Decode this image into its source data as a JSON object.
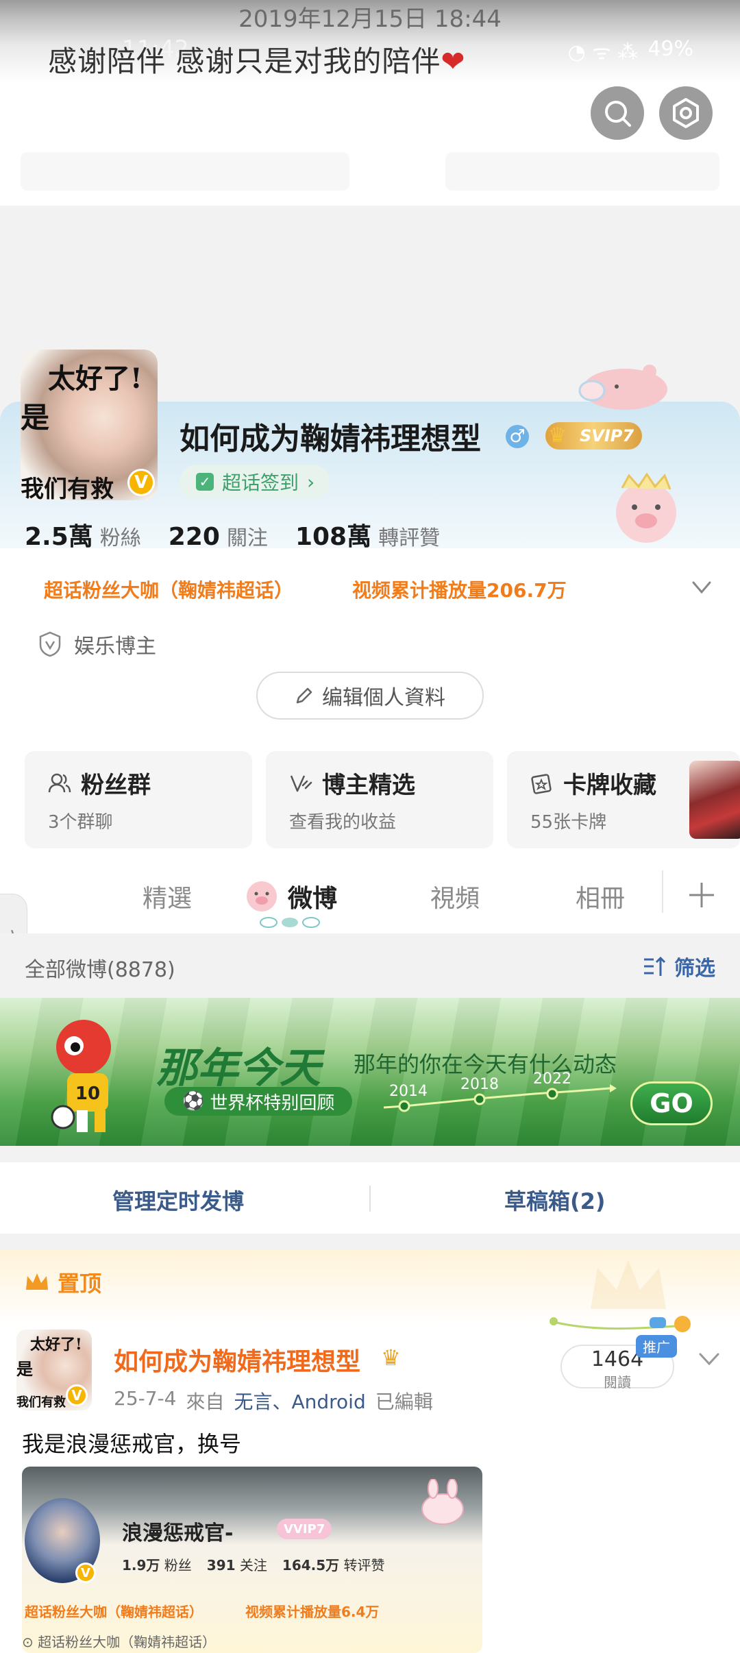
{
  "overlay": {
    "date": "2019年12月15日 18:44",
    "status_time": "11:42",
    "battery": "49%",
    "comment": "感谢陪伴 感谢只是对我的陪伴"
  },
  "profile": {
    "name": "如何成为鞠婧祎理想型",
    "svip": "SVIP7",
    "checkin": "超话签到",
    "stats": [
      {
        "num": "2.5萬",
        "label": "粉絲"
      },
      {
        "num": "220",
        "label": "關注"
      },
      {
        "num": "108萬",
        "label": "轉評贊"
      }
    ],
    "tags": [
      "超话粉丝大咖（鞠婧祎超话）",
      "视频累计播放量206.7万"
    ],
    "role": "娱乐博主",
    "edit_label": "编辑個人資料",
    "avatar_text": [
      "太好了!",
      "是",
      "我们有救"
    ]
  },
  "features": [
    {
      "title": "粉丝群",
      "sub": "3个群聊"
    },
    {
      "title": "博主精选",
      "sub": "查看我的收益"
    },
    {
      "title": "卡牌收藏",
      "sub": "55张卡牌"
    }
  ],
  "tabs": [
    "精選",
    "微博",
    "視頻",
    "相冊"
  ],
  "feed": {
    "count_label": "全部微博(8878)",
    "filter_label": "筛选"
  },
  "banner": {
    "title": "那年今天",
    "subtitle": "那年的你在今天有什么动态",
    "pill": "世界杯特别回顾",
    "years": [
      "2014",
      "2018",
      "2022"
    ],
    "go": "GO",
    "jersey": "10"
  },
  "manage": {
    "scheduled": "管理定时发博",
    "drafts": "草稿箱(2)"
  },
  "post": {
    "pinned": "置顶",
    "author": "如何成为鞠婧祎理想型",
    "date": "25-7-4",
    "from": "來自",
    "source": "无言、Android",
    "edited": "已編輯",
    "reads": "1464",
    "reads_label": "閱讀",
    "promo": "推广",
    "text": "我是浪漫惩戒官，换号",
    "embed": {
      "name": "浪漫惩戒官-",
      "vip": "VVIP7",
      "stats": [
        {
          "num": "1.9万",
          "label": "粉丝"
        },
        {
          "num": "391",
          "label": "关注"
        },
        {
          "num": "164.5万",
          "label": "转评赞"
        }
      ],
      "tags": [
        "超话粉丝大咖（鞠婧祎超话）",
        "视频累计播放量6.4万"
      ],
      "role": "超话粉丝大咖（鞠婧祎超话）"
    }
  },
  "colors": {
    "accent_orange": "#f07c1c",
    "link_blue": "#3a5a8a",
    "checkin_green": "#3da06a"
  }
}
